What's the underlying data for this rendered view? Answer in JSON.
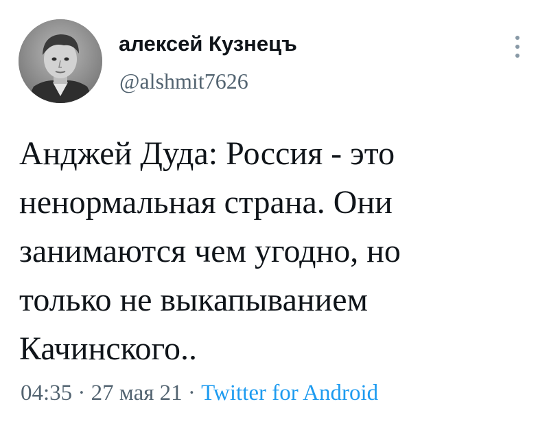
{
  "user": {
    "display_name": "алексей Кузнецъ",
    "handle": "@alshmit7626",
    "avatar_icon": "profile-photo"
  },
  "tweet": {
    "lines": [
      "Анджей Дуда: Россия - это",
      "ненормальная страна. Они",
      "занимаются чем угодно, но",
      "только не выкапыванием",
      "Качинского.."
    ]
  },
  "meta": {
    "time": "04:35",
    "separator_1": " · ",
    "date": "27 мая 21",
    "separator_2": " · ",
    "source": "Twitter for Android"
  },
  "colors": {
    "text": "#0f1419",
    "secondary": "#536471",
    "link": "#1d9bf0"
  }
}
